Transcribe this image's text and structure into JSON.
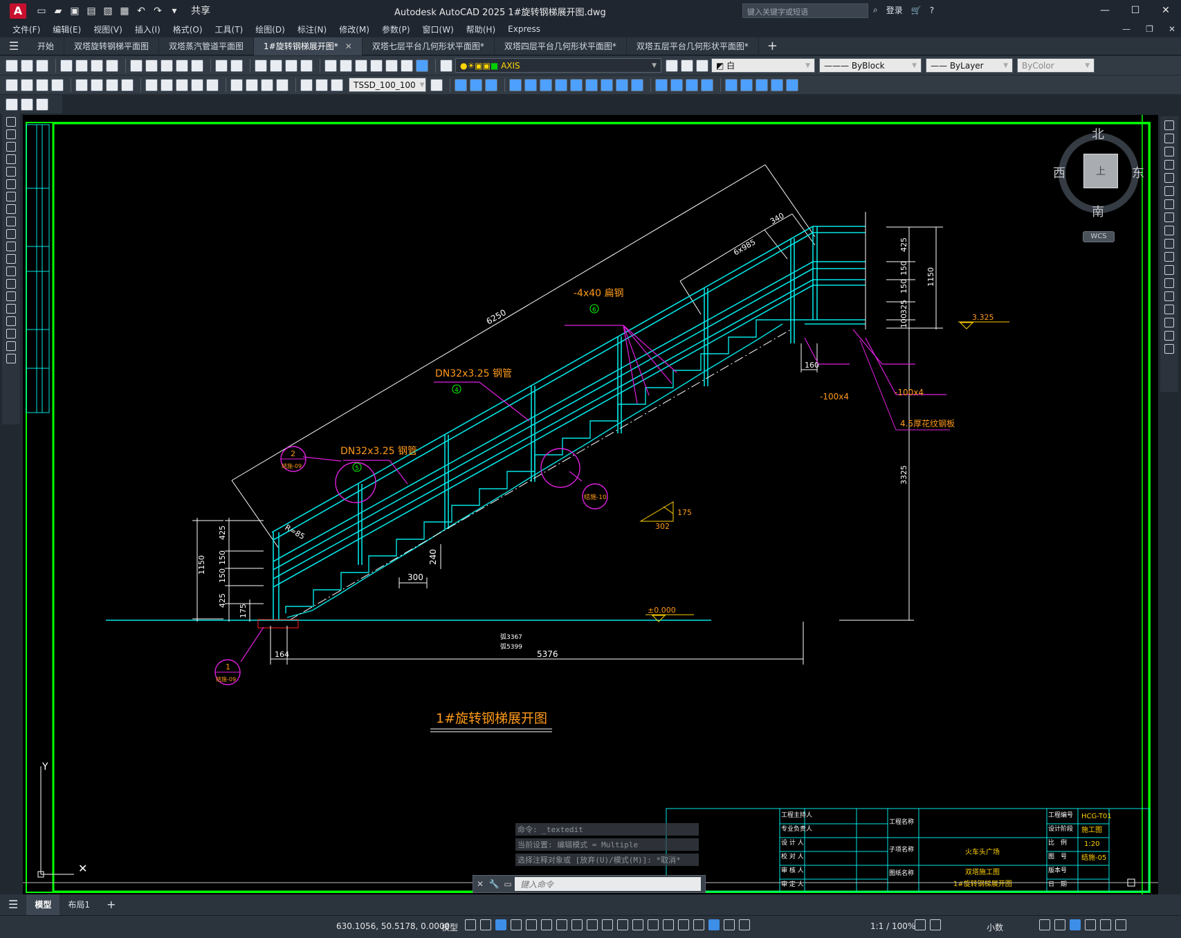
{
  "window": {
    "app_icon": "A",
    "title": "Autodesk AutoCAD 2025    1#旋转钢梯展开图.dwg",
    "share_label": "共享",
    "search_placeholder": "键入关键字或短语",
    "login_label": "登录"
  },
  "menu": [
    "文件(F)",
    "编辑(E)",
    "视图(V)",
    "插入(I)",
    "格式(O)",
    "工具(T)",
    "绘图(D)",
    "标注(N)",
    "修改(M)",
    "参数(P)",
    "窗口(W)",
    "帮助(H)",
    "Express"
  ],
  "tabs": [
    {
      "label": "开始",
      "active": false
    },
    {
      "label": "双塔旋转钢梯平面图",
      "active": false
    },
    {
      "label": "双塔蒸汽管道平面图",
      "active": false
    },
    {
      "label": "1#旋转钢梯展开图*",
      "active": true
    },
    {
      "label": "双塔七层平台几何形状平面图*",
      "active": false
    },
    {
      "label": "双塔四层平台几何形状平面图*",
      "active": false
    },
    {
      "label": "双塔五层平台几何形状平面图*",
      "active": false
    }
  ],
  "toolbar": {
    "layer_name": "AXIS",
    "color_name": "白",
    "linetype": "ByBlock",
    "lineweight": "ByLayer",
    "plotstyle": "ByColor",
    "dimstyle": "TSSD_100_100"
  },
  "viewcube": {
    "north": "北",
    "south": "南",
    "west": "西",
    "east": "东",
    "wcs": "WCS",
    "face": "上"
  },
  "drawing": {
    "title": "1#旋转钢梯展开图",
    "dim_overall_slope": "6250",
    "dim_top": "340",
    "dim_step_run": "6x985",
    "dim_right_heights": [
      "425",
      "150",
      "150",
      "325",
      "100"
    ],
    "dim_right_total": "1150",
    "dim_left_heights": [
      "425",
      "150",
      "150",
      "425"
    ],
    "dim_left_total": "1150",
    "dim_left_175": "175",
    "dim_tread": "300",
    "dim_riser": "240",
    "dim_bottom_164": "164",
    "dim_bottom_total": "5376",
    "dim_height_total": "3325",
    "dim_160": "160",
    "radius_label": "R=85",
    "slope_val1": "175",
    "slope_val2": "302",
    "level_top": "3.325",
    "level_ground": "±0.000",
    "anno_flat_steel": "-4x40 扁钢",
    "anno_flat_steel_num": "6",
    "anno_pipe_upper": "DN32x3.25 钢管",
    "anno_pipe_upper_num": "4",
    "anno_pipe_lower": "DN32x3.25 钢管",
    "anno_pipe_lower_num": "5",
    "anno_100x4_a": "-100x4",
    "anno_100x4_b": "-100x4",
    "anno_plate": "4.5厚花纹钢板",
    "detail_2_num": "2",
    "detail_2_ref": "结施-09",
    "detail_10_ref": "结施-10",
    "detail_1_num": "1",
    "detail_1_ref": "结施-09",
    "small_text_1": "弧3367",
    "small_text_2": "弧5399"
  },
  "titleblock": {
    "project_label": "工程名称",
    "subproject_label": "子项名称",
    "drawing_label": "图纸名称",
    "project_value": "火车头广场",
    "subproject_value": "双塔施工图",
    "drawing_value": "1#旋转钢梯展开图",
    "project_no_label": "工程编号",
    "stage_label": "设计阶段",
    "scale_label": "比　例",
    "dwgno_label": "图　号",
    "version_label": "版本号",
    "date_label": "日　期",
    "project_no": "HCG-T01",
    "stage": "施工图",
    "scale": "1:20",
    "dwgno": "结施-05",
    "roles": [
      "工程主持人",
      "专业负责人",
      "设 计 人",
      "校 对 人",
      "审 核 人",
      "审 定 人"
    ]
  },
  "command": {
    "history": [
      "命令: _textedit",
      "当前设置: 编辑模式 = Multiple",
      "选择注释对象或 [放弃(U)/模式(M)]: *取消*"
    ],
    "placeholder": "键入命令"
  },
  "layout_tabs": [
    "模型",
    "布局1"
  ],
  "status": {
    "coords": "630.1056, 50.5178, 0.0000",
    "model": "模型",
    "scale": "1:1 / 100%",
    "units": "小数"
  },
  "colors": {
    "green_frame": "#00ff00",
    "cyan": "#00e5e5",
    "magenta": "#e020e0",
    "orange": "#ff9a1a",
    "white": "#ffffff"
  }
}
